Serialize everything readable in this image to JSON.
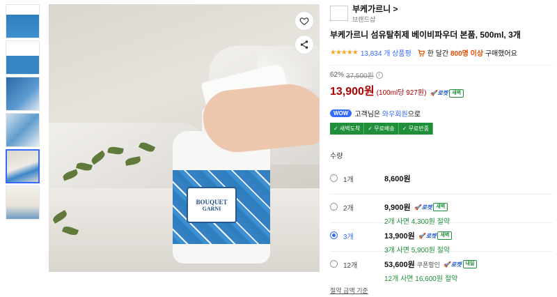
{
  "seller": {
    "name": "부케가르니",
    "chevron": ">",
    "subtitle": "브랜드샵"
  },
  "product": {
    "title": "부케가르니 섬유탈취제 베이비파우더 본품, 500ml, 3개",
    "label_line1": "BOUQUET",
    "label_line2": "GARNI"
  },
  "rating": {
    "stars_value": 4.5,
    "stars": "★★★★★",
    "review_count": "13,834 개 상품평",
    "bought_prefix": "한 달간",
    "bought_count": "800명 이상",
    "bought_suffix": "구매했어요"
  },
  "price": {
    "discount": "62%",
    "original": "37,500원",
    "info": "i",
    "current": "13,900원",
    "unit": "(100ml당 927원)",
    "rocket": "로켓",
    "badge": "새벽"
  },
  "wow": {
    "badge": "WOW",
    "prefix": "고객님은",
    "member": "와우회원",
    "suffix": "으로"
  },
  "benefits": [
    "✓ 새벽도착",
    "✓ 무료배송",
    "✓ 무료반품"
  ],
  "quantity_label": "수량",
  "options": [
    {
      "name": "1개",
      "price": "8,600원",
      "coupon": "",
      "rocket": "",
      "badge": "",
      "save": "",
      "selected": false
    },
    {
      "name": "2개",
      "price": "9,900원",
      "coupon": "",
      "rocket": "로켓",
      "badge": "새벽",
      "save": "2개 사면 4,300원 절약",
      "selected": false
    },
    {
      "name": "3개",
      "price": "13,900원",
      "coupon": "",
      "rocket": "로켓",
      "badge": "새벽",
      "save": "3개 사면 5,900원 절약",
      "selected": true
    },
    {
      "name": "12개",
      "price": "53,600원",
      "coupon": "쿠폰할인",
      "rocket": "로켓",
      "badge": "내일",
      "save": "12개 사면 16,600원 절약",
      "selected": false
    }
  ],
  "footer_link": "절약 금액 기준",
  "colors": {
    "accent": "#346aff",
    "price_red": "#ae0000",
    "green": "#1f8f3a"
  }
}
